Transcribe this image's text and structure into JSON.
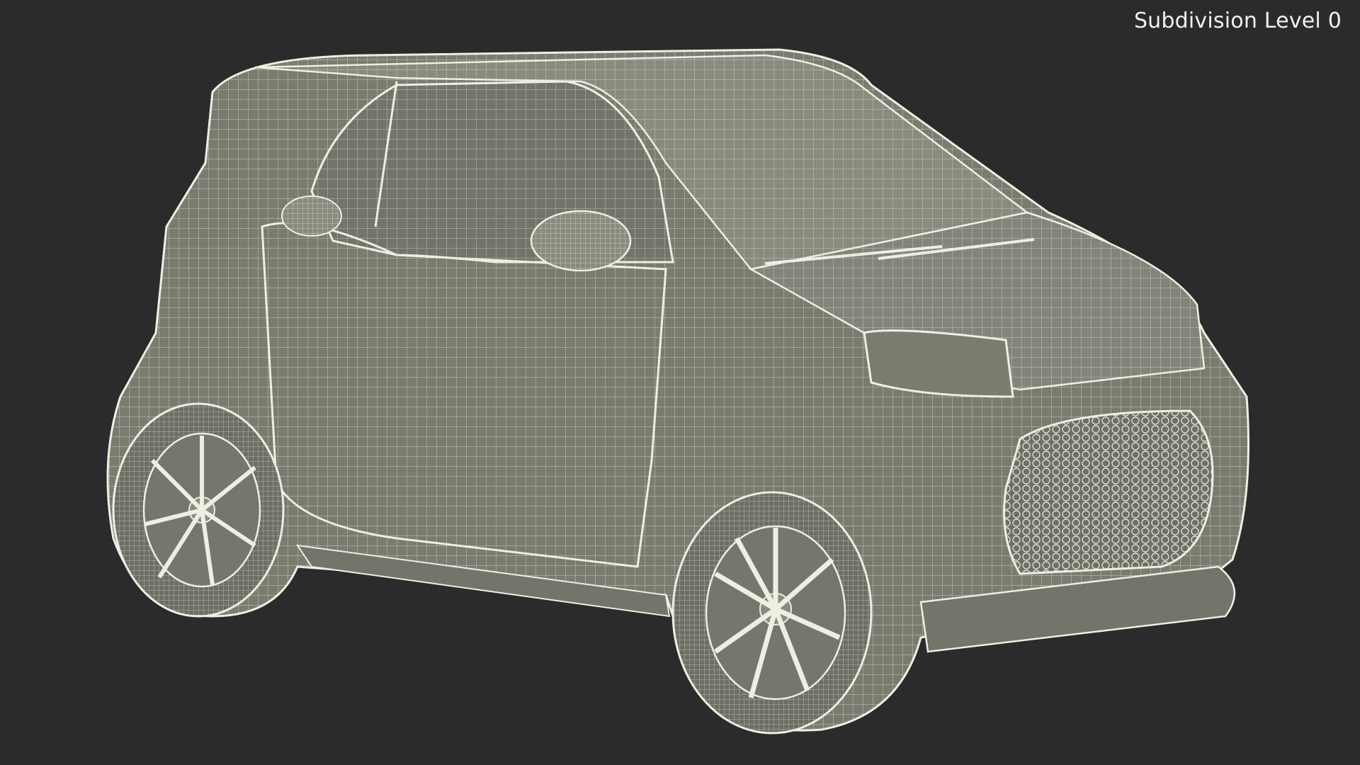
{
  "viewport": {
    "label": "Subdivision Level 0",
    "background": "#2b2b2b"
  },
  "model": {
    "description_icon": "car-wireframe-icon",
    "body_color": "#7b7b70",
    "wire_color": "#efeee2"
  }
}
